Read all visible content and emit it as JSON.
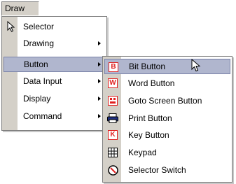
{
  "menubar": {
    "label": "Draw"
  },
  "main_menu": {
    "items": [
      {
        "label": "Selector",
        "has_submenu": false,
        "icon": "arrow-cursor-icon"
      },
      {
        "label": "Drawing",
        "has_submenu": true
      },
      {
        "label": "Button",
        "has_submenu": true,
        "active": true
      },
      {
        "label": "Data Input",
        "has_submenu": true
      },
      {
        "label": "Display",
        "has_submenu": true
      },
      {
        "label": "Command",
        "has_submenu": true
      }
    ]
  },
  "sub_menu": {
    "items": [
      {
        "label": "Bit Button",
        "icon": "bit-button-icon",
        "icon_glyph": "B",
        "icon_color": "#e02020",
        "active": true
      },
      {
        "label": "Word Button",
        "icon": "word-button-icon",
        "icon_glyph": "W",
        "icon_color": "#e02020"
      },
      {
        "label": "Goto Screen Button",
        "icon": "goto-screen-button-icon",
        "icon_glyph": "▤",
        "icon_color": "#e02020"
      },
      {
        "label": "Print Button",
        "icon": "print-button-icon",
        "icon_glyph": "⎙",
        "icon_color": "#203080"
      },
      {
        "label": "Key Button",
        "icon": "key-button-icon",
        "icon_glyph": "K",
        "icon_color": "#e02020"
      },
      {
        "label": "Keypad",
        "icon": "keypad-icon",
        "icon_glyph": "▦",
        "icon_color": "#000000"
      },
      {
        "label": "Selector Switch",
        "icon": "selector-switch-icon",
        "icon_glyph": "⦸",
        "icon_color": "#000000"
      }
    ]
  },
  "colors": {
    "highlight": "#b0b6ce",
    "menu_strip": "#d4d0c8",
    "icon_red": "#e02020"
  }
}
